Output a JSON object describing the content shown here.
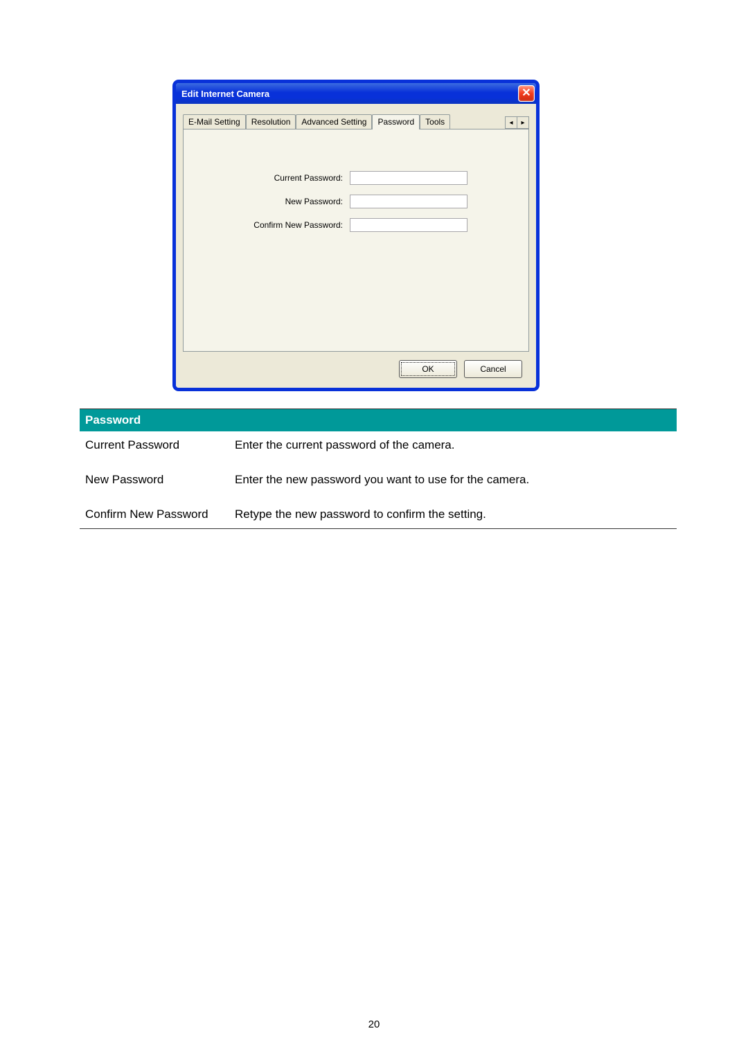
{
  "dialog": {
    "title": "Edit Internet Camera",
    "tabs": {
      "email": "E-Mail Setting",
      "resolution": "Resolution",
      "advanced": "Advanced Setting",
      "password": "Password",
      "tools": "Tools"
    },
    "form": {
      "current_label": "Current Password:",
      "new_label": "New Password:",
      "confirm_label": "Confirm New Password:",
      "current_value": "",
      "new_value": "",
      "confirm_value": ""
    },
    "buttons": {
      "ok": "OK",
      "cancel": "Cancel"
    },
    "scroll": {
      "left": "◂",
      "right": "▸"
    }
  },
  "table": {
    "header": "Password",
    "rows": [
      {
        "name": "Current Password",
        "desc": "Enter the current password of the camera."
      },
      {
        "name": "New Password",
        "desc": "Enter the new password you want to use for the camera."
      },
      {
        "name": "Confirm New Password",
        "desc": "Retype the new password to confirm the setting."
      }
    ]
  },
  "page_number": "20"
}
